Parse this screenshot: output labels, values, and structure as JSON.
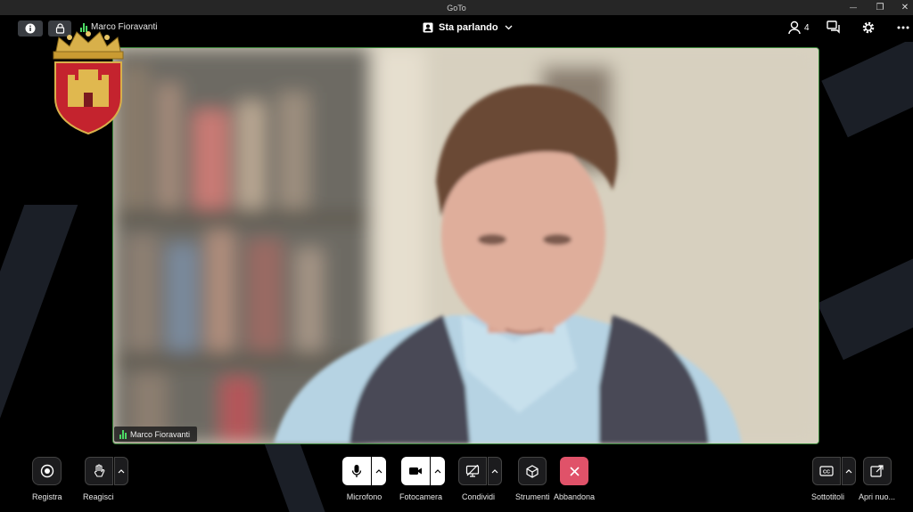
{
  "window": {
    "title": "GoTo",
    "minimize": "—",
    "restore": "❐",
    "close": "✕"
  },
  "topbar": {
    "speaker_name": "Marco Fioravanti",
    "view_selector": "Sta parlando",
    "participants_count": "4"
  },
  "video": {
    "name_tag": "Marco Fioravanti"
  },
  "toolbar": {
    "record": "Registra",
    "react": "Reagisci",
    "microphone": "Microfono",
    "camera": "Fotocamera",
    "share": "Condividi",
    "tools": "Strumenti",
    "leave": "Abbandona",
    "subtitles": "Sottotitoli",
    "open_new": "Apri nuo..."
  },
  "colors": {
    "accent_green": "#4cd964",
    "leave_red": "#e05269",
    "video_border": "#3c8a3c"
  },
  "icons": [
    "info-icon",
    "lock-icon",
    "audio-bars-icon",
    "speaker-view-icon",
    "chevron-down-icon",
    "participants-icon",
    "chat-icon",
    "gear-icon",
    "more-icon",
    "record-icon",
    "hand-icon",
    "microphone-icon",
    "camera-icon",
    "share-screen-icon",
    "cube-icon",
    "close-icon",
    "cc-icon",
    "popout-icon",
    "chevron-up-icon"
  ]
}
